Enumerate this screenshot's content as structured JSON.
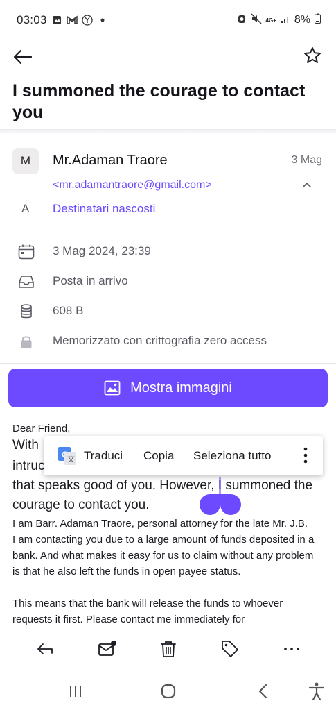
{
  "status_bar": {
    "time": "03:03",
    "battery": "8%",
    "network": "4G+"
  },
  "email": {
    "subject": "I summoned the courage to contact you",
    "sender_initial": "M",
    "sender_name": "Mr.Adaman Traore",
    "date_short": "3 Mag",
    "sender_email": "<mr.adamantraore@gmail.com>",
    "recipient_initial": "A",
    "recipients_label": "Destinatari nascosti",
    "details": {
      "datetime": "3 Mag 2024, 23:39",
      "folder": "Posta in arrivo",
      "size": "608 B",
      "encryption": "Memorizzato con crittografia zero access"
    }
  },
  "show_images_label": "Mostra immagini",
  "body": {
    "greeting": "Dear Friend,",
    "line1_start": " With",
    "line2_start": "intruc",
    "line3": "that speaks good of you. However, I summoned the",
    "line4": "courage to contact you.",
    "para2": [
      " I am Barr. Adaman Traore, personal attorney for the late Mr. J.B.",
      "I am contacting you due to a large amount of funds deposited in a",
      "bank. And what makes it easy for us to claim without any problem",
      "is that he also left the funds in open payee status."
    ],
    "para3": [
      "This means that the bank will release the funds to whoever",
      "requests it first. Please contact me immediately for"
    ]
  },
  "context_menu": {
    "translate": "Traduci",
    "copy": "Copia",
    "select_all": "Seleziona tutto"
  },
  "colors": {
    "accent": "#6d4aff",
    "text_primary": "#1c1b22",
    "text_secondary": "#5a5862"
  },
  "icons": {
    "back": "back-arrow-icon",
    "star": "star-icon",
    "calendar": "calendar-icon",
    "inbox": "inbox-icon",
    "storage": "database-icon",
    "lock": "lock-icon",
    "image": "image-icon",
    "reply": "reply-icon",
    "unread": "mark-unread-icon",
    "trash": "trash-icon",
    "label": "tag-icon",
    "more": "more-icon"
  }
}
